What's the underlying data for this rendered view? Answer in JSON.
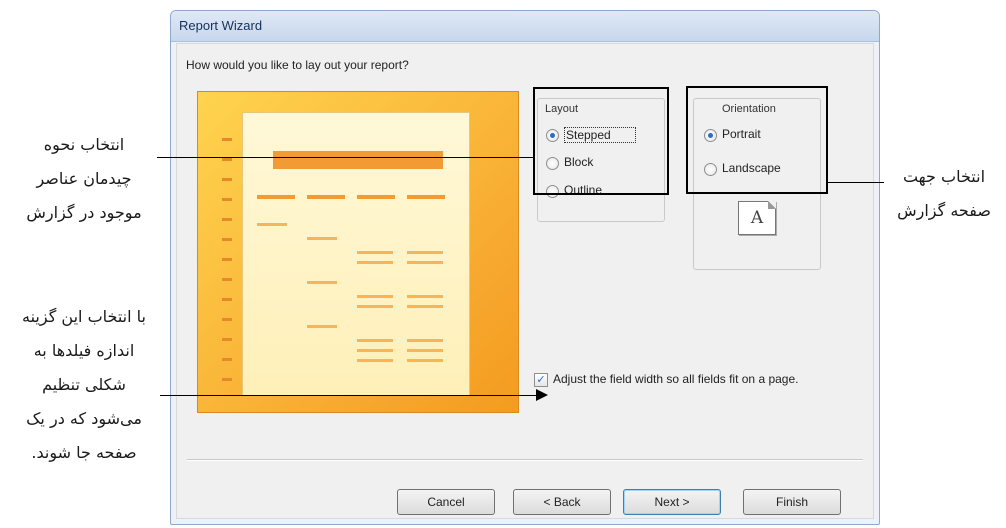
{
  "window": {
    "title": "Report Wizard"
  },
  "wizard": {
    "question": "How would you like to lay out your report?",
    "layout": {
      "title": "Layout",
      "options": [
        {
          "label": "Stepped",
          "selected": true
        },
        {
          "label": "Block",
          "selected": false
        },
        {
          "label": "Outline",
          "selected": false
        }
      ]
    },
    "orientation": {
      "title": "Orientation",
      "options": [
        {
          "label": "Portrait",
          "selected": true
        },
        {
          "label": "Landscape",
          "selected": false
        }
      ],
      "icon_letter": "A"
    },
    "adjust_width": {
      "checked": true,
      "label": "Adjust the field width so all fields fit on a page."
    },
    "buttons": {
      "cancel": "Cancel",
      "back": "< Back",
      "next": "Next >",
      "finish": "Finish"
    }
  },
  "annotations": {
    "layout_note": [
      "انتخاب نحوه",
      "چیدمان عناصر",
      "موجود در گزارش"
    ],
    "orientation_note": [
      "انتخاب جهت",
      "صفحه گزارش"
    ],
    "adjust_note": [
      "با انتخاب این گزینه",
      "اندازه فیلدها به",
      "شکلی تنظیم",
      "می‌شود که در یک",
      "صفحه جا شوند."
    ]
  },
  "colors": {
    "preview_orange": "#f39c1f",
    "accent_blue": "#2a6cc8"
  }
}
